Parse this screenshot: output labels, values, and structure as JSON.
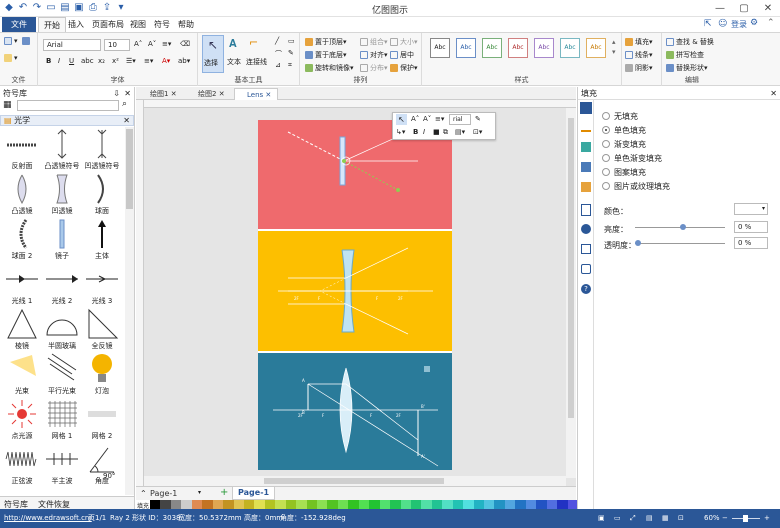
{
  "app": {
    "title": "亿图图示"
  },
  "menu": {
    "file": "文件",
    "tabs": [
      "开始",
      "插入",
      "页面布局",
      "视图",
      "符号",
      "帮助"
    ]
  },
  "topright": {
    "login": "登录"
  },
  "ribbon": {
    "file_group": "文件",
    "font": {
      "name": "Arial",
      "size": "10",
      "label": "字体"
    },
    "tools": {
      "select": "选择",
      "text": "文本",
      "connector": "连接线",
      "label": "基本工具"
    },
    "arrange": {
      "front": "置于顶层",
      "back": "置于底层",
      "rotate": "旋转和镜像",
      "group": "组合",
      "align": "对齐",
      "distribute": "分布",
      "size": "大小",
      "center": "居中",
      "protect": "保护",
      "label": "排列"
    },
    "styles_label": "样式",
    "styles": [
      "Abc",
      "Abc",
      "Abc",
      "Abc",
      "Abc",
      "Abc",
      "Abc"
    ],
    "format": {
      "fill": "填充",
      "line": "线条",
      "shadow": "阴影"
    },
    "edit": {
      "find": "查找 & 替换",
      "spell": "拼写检查",
      "replace": "替换形状",
      "label": "编辑"
    }
  },
  "symbols": {
    "title": "符号库",
    "category": "光学",
    "items": [
      "反射面",
      "凸透镜符号",
      "凹透镜符号",
      "凸透镜",
      "凹透镜",
      "球面",
      "球面 2",
      "镜子",
      "主体",
      "光线 1",
      "光线 2",
      "光线 3",
      "棱镜",
      "半圆玻璃",
      "全反镜",
      "光束",
      "平行光束",
      "灯泡",
      "点光源",
      "网格 1",
      "网格 2",
      "正弦波",
      "半主波",
      "角度"
    ],
    "angle_label": "90°",
    "bottom_tabs": [
      "符号库",
      "文件恢复"
    ]
  },
  "documents": {
    "tabs": [
      "绘图1",
      "绘图2",
      "Lens"
    ]
  },
  "floating_toolbar": {
    "font": "rial"
  },
  "diagram": {
    "panels": [
      {
        "color": "#ef6a6d"
      },
      {
        "color": "#fdbf00",
        "labels": [
          "2F",
          "F",
          "F",
          "2F"
        ]
      },
      {
        "color": "#2a7b9a",
        "labels": [
          "2F",
          "F",
          "F",
          "2F",
          "A",
          "B",
          "A'",
          "B'"
        ]
      }
    ]
  },
  "pages": {
    "items": [
      "Page-1",
      "Page-1"
    ]
  },
  "right_panel": {
    "title": "填充",
    "options": [
      "无填充",
      "单色填充",
      "渐变填充",
      "单色渐变填充",
      "图案填充",
      "图片或纹理填充"
    ],
    "selected": 1,
    "color_label": "颜色：",
    "brightness_label": "亮度：",
    "brightness_value": "0 %",
    "transparency_label": "透明度：",
    "transparency_value": "0 %"
  },
  "palette_label": "填充",
  "status": {
    "url": "http://www.edrawsoft.cn/",
    "page": "页1/1",
    "shape": "Ray 2",
    "shape_id": "形状 ID：3038",
    "width": "宽度：50.5372mm",
    "height": "高度：0mm",
    "angle": "角度：-152.928deg",
    "zoom": "60%"
  },
  "colors": {
    "accent": "#2b5797",
    "red_panel": "#ef6a6d",
    "yellow_panel": "#fdbf00",
    "blue_panel": "#2a7b9a"
  }
}
